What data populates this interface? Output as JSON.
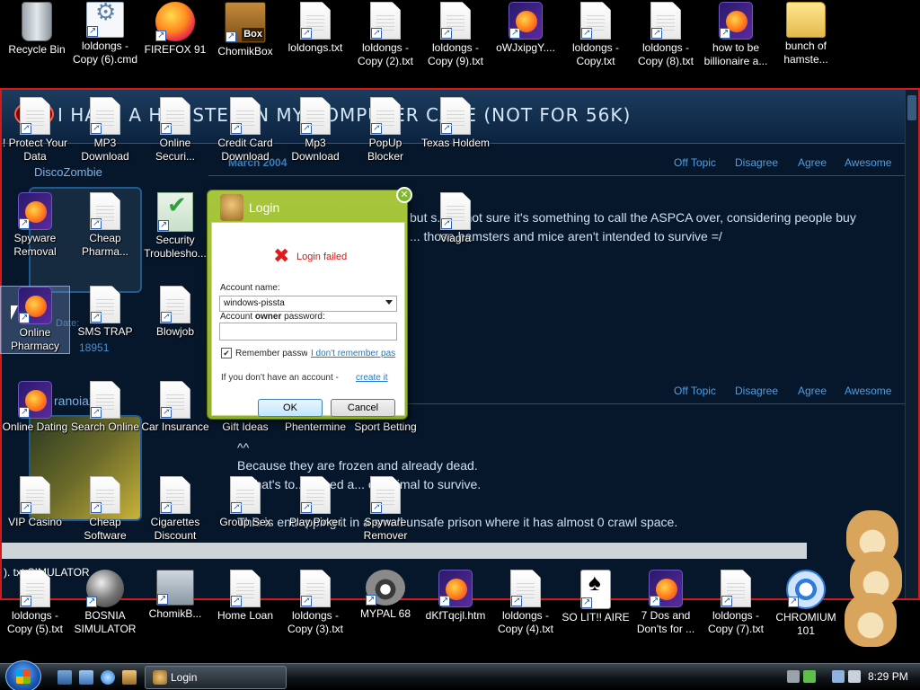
{
  "desktop_top_icons": [
    {
      "label": "Recycle Bin",
      "kind": "recycle"
    },
    {
      "label": "loldongs - Copy (6).cmd",
      "kind": "cmd"
    },
    {
      "label": "FIREFOX 91",
      "kind": "firefox"
    },
    {
      "label": "ChomikBox",
      "kind": "box",
      "badge": "Box"
    },
    {
      "label": "loldongs.txt",
      "kind": "doc"
    },
    {
      "label": "loldongs - Copy (2).txt",
      "kind": "doc"
    },
    {
      "label": "loldongs - Copy (9).txt",
      "kind": "doc"
    },
    {
      "label": "oWJxipgY....",
      "kind": "firefox-file"
    },
    {
      "label": "loldongs - Copy.txt",
      "kind": "doc"
    },
    {
      "label": "loldongs - Copy (8).txt",
      "kind": "doc"
    },
    {
      "label": "how to be billionaire a...",
      "kind": "firefox-file"
    },
    {
      "label": "bunch of hamste...",
      "kind": "folder"
    }
  ],
  "desktop_overlay_icons": [
    {
      "label": "! Protect Your Data",
      "kind": "doc"
    },
    {
      "label": "MP3 Download",
      "kind": "doc"
    },
    {
      "label": "Online Securi...",
      "kind": "doc"
    },
    {
      "label": "Credit Card Download",
      "kind": "doc"
    },
    {
      "label": "Mp3 Download",
      "kind": "doc"
    },
    {
      "label": "PopUp Blocker",
      "kind": "doc"
    },
    {
      "label": "Texas Holdem",
      "kind": "doc"
    },
    {
      "label": "Spyware Removal",
      "kind": "firefox-file"
    },
    {
      "label": "Cheap Pharma...",
      "kind": "doc"
    },
    {
      "label": "Security Troublesho...",
      "kind": "security"
    },
    {
      "label": "Viagra",
      "kind": "doc"
    },
    {
      "label": "Online Pharmacy",
      "kind": "firefox-file"
    },
    {
      "label": "SMS TRAP",
      "kind": "doc"
    },
    {
      "label": "Blowjob",
      "kind": "doc"
    },
    {
      "label": "Online Dating",
      "kind": "firefox-file"
    },
    {
      "label": "Search Online",
      "kind": "doc"
    },
    {
      "label": "Car Insurance",
      "kind": "doc"
    },
    {
      "label": "Gift Ideas",
      "kind": "doc"
    },
    {
      "label": "Phentermine",
      "kind": "doc"
    },
    {
      "label": "Sport Betting",
      "kind": "doc"
    },
    {
      "label": "VIP Casino",
      "kind": "doc"
    },
    {
      "label": "Cheap Software",
      "kind": "doc"
    },
    {
      "label": "Cigarettes Discount",
      "kind": "doc"
    },
    {
      "label": "Group Sex",
      "kind": "doc"
    },
    {
      "label": "Play Poker",
      "kind": "doc"
    },
    {
      "label": "Spyware Remover",
      "kind": "doc"
    }
  ],
  "desktop_bottom_icons": [
    {
      "label": "loldongs - Copy (5).txt",
      "kind": "doc"
    },
    {
      "label": "BOSNIA SIMULATOR",
      "kind": "mine"
    },
    {
      "label": "ChomikB...",
      "kind": "pc"
    },
    {
      "label": "Home Loan",
      "kind": "doc"
    },
    {
      "label": "loldongs - Copy (3).txt",
      "kind": "doc"
    },
    {
      "label": "MYPAL 68",
      "kind": "raccoon"
    },
    {
      "label": "dKfTqcjl.htm",
      "kind": "firefox-file"
    },
    {
      "label": "loldongs - Copy (4).txt",
      "kind": "doc"
    },
    {
      "label": "SO LIT!! AIRE",
      "kind": "cards"
    },
    {
      "label": "7 Dos and Don'ts for ...",
      "kind": "firefox-file"
    },
    {
      "label": "loldongs - Copy (7).txt",
      "kind": "doc"
    },
    {
      "label": "CHROMIUM 101",
      "kind": "chrome"
    }
  ],
  "browser_page": {
    "title": "I HAVE A HAMSTER IN MY COMPUTER CASE (NOT FOR 56K)",
    "post1_date": "March 2004",
    "post1_user": "DiscoZombie",
    "post1_join_date_fragment": "Date:",
    "post1_post_number": "18951",
    "post1_text_line1": "but s... m not sure it's something to call the ASPCA over, considering people buy",
    "post1_text_line2": "... those hamsters and mice aren't intended to survive =/",
    "post2_user": "ranoia2",
    "post2_quote": "^^",
    "post2_text_line1": "Because they are frozen and already dead.",
    "post2_text_line2": "... that's to... o feed a... er animal to survive.",
    "post2_text_line3": "This is entrapping it in a small unsafe prison where it has almost 0 crawl space.",
    "rating_links": [
      "Off Topic",
      "Disagree",
      "Agree",
      "Awesome"
    ],
    "footer_fragment": "). txt SIMULATOR"
  },
  "login_dialog": {
    "title": "Login",
    "error": "Login failed",
    "account_name_label": "Account name:",
    "account_name_value": "windows-pissta",
    "password_label_pre": "Account ",
    "password_label_bold": "owner",
    "password_label_post": " password:",
    "password_value": "",
    "remember_label": "Remember passw",
    "remember_checked": true,
    "forgot_link": "I don't remember pas",
    "no_account_text": "If you don't have an account - ",
    "create_link": "create it",
    "ok_label": "OK",
    "cancel_label": "Cancel"
  },
  "taskbar": {
    "task_label": "Login",
    "clock": "8:29 PM"
  },
  "colors": {
    "page_border": "#d21a1a",
    "dialog_green": "#a7c63b",
    "link_blue": "#1a79c9",
    "error_red": "#e01b1b"
  }
}
